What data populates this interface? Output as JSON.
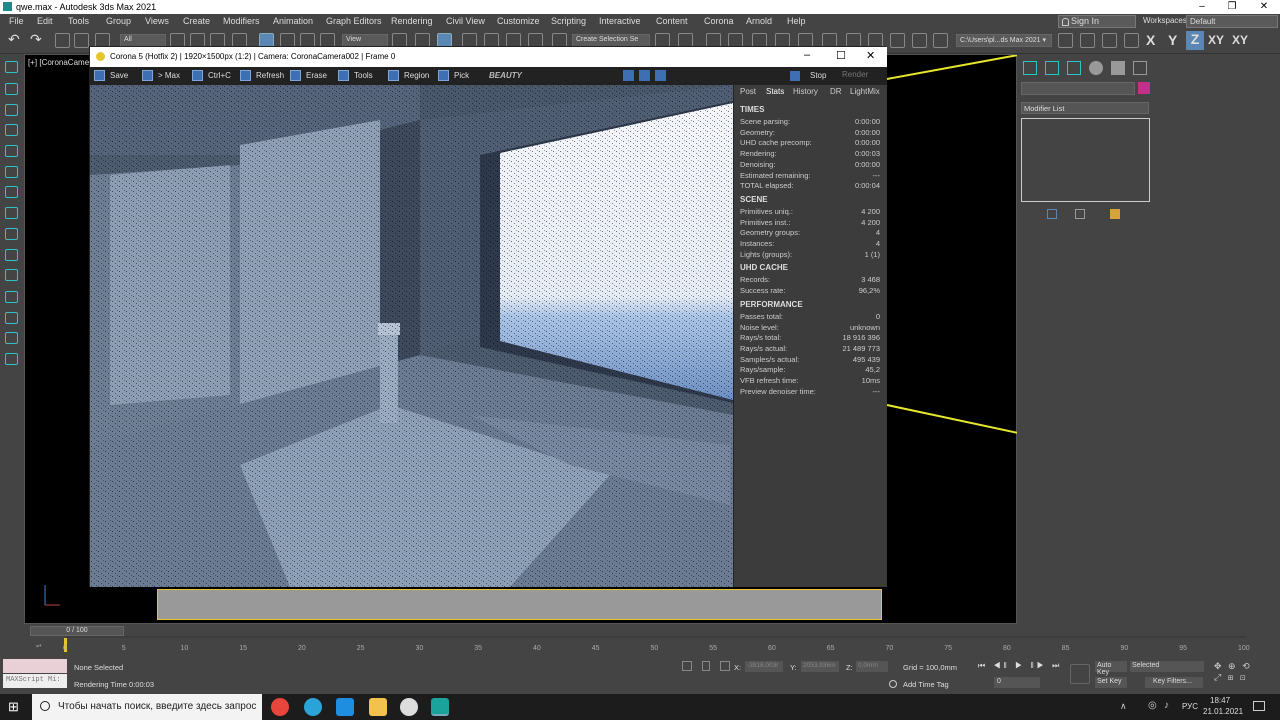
{
  "app": {
    "title": "qwe.max - Autodesk 3ds Max 2021"
  },
  "menu": [
    "File",
    "Edit",
    "Tools",
    "Group",
    "Views",
    "Create",
    "Modifiers",
    "Animation",
    "Graph Editors",
    "Rendering",
    "Civil View",
    "Customize",
    "Scripting",
    "Interactive",
    "Content",
    "Corona",
    "Arnold",
    "Help"
  ],
  "account": {
    "sign_in": "Sign In",
    "workspaces_label": "Workspaces:",
    "workspace": "Default"
  },
  "toolbar": {
    "filter": "All",
    "view": "View",
    "selection_set": "Create Selection Se",
    "path": "C:\\Users\\pl...ds Max 2021 ▾",
    "axes": [
      "X",
      "Y",
      "Z",
      "XY",
      "XY"
    ]
  },
  "viewport": {
    "label": "[+] [CoronaCamer"
  },
  "vfb": {
    "title": "Corona 5 (Hotfix 2) | 1920×1500px (1:2) | Camera: CoronaCamera002 | Frame 0",
    "buttons": [
      "Save",
      "> Max",
      "Ctrl+C",
      "Refresh",
      "Erase",
      "Tools",
      "Region",
      "Pick"
    ],
    "channel": "BEAUTY",
    "stop": "Stop",
    "render": "Render",
    "tabs": [
      "Post",
      "Stats",
      "History",
      "DR",
      "LightMix"
    ],
    "sections": {
      "times": {
        "title": "TIMES",
        "rows": [
          [
            "Scene parsing:",
            "0:00:00"
          ],
          [
            "Geometry:",
            "0:00:00"
          ],
          [
            "UHD cache precomp:",
            "0:00:00"
          ],
          [
            "Rendering:",
            "0:00:03"
          ],
          [
            "Denoising:",
            "0:00:00"
          ],
          [
            "Estimated remaining:",
            "---"
          ],
          [
            "TOTAL elapsed:",
            "0:00:04"
          ]
        ]
      },
      "scene": {
        "title": "SCENE",
        "rows": [
          [
            "Primitives uniq.:",
            "4 200"
          ],
          [
            "Primitives inst.:",
            "4 200"
          ],
          [
            "Geometry groups:",
            "4"
          ],
          [
            "Instances:",
            "4"
          ],
          [
            "Lights (groups):",
            "1 (1)"
          ]
        ]
      },
      "uhd": {
        "title": "UHD CACHE",
        "rows": [
          [
            "Records:",
            "3 468"
          ],
          [
            "Success rate:",
            "96,2%"
          ]
        ]
      },
      "perf": {
        "title": "PERFORMANCE",
        "rows": [
          [
            "Passes total:",
            "0"
          ],
          [
            "Noise level:",
            "unknown"
          ],
          [
            "Rays/s total:",
            "18 916 396"
          ],
          [
            "Rays/s actual:",
            "21 489 773"
          ],
          [
            "Samples/s actual:",
            "495 439"
          ],
          [
            "Rays/sample:",
            "45,2"
          ],
          [
            "VFB refresh time:",
            "10ms"
          ],
          [
            "Preview denoiser time:",
            "---"
          ]
        ]
      }
    }
  },
  "rightpanel": {
    "modifier_list": "Modifier List"
  },
  "timeline": {
    "frame": "0 / 100",
    "ticks": [
      "0",
      "5",
      "10",
      "15",
      "20",
      "25",
      "30",
      "35",
      "40",
      "45",
      "50",
      "55",
      "60",
      "65",
      "70",
      "75",
      "80",
      "85",
      "90",
      "95",
      "100"
    ]
  },
  "status": {
    "maxscript": "MAXScript Mi:",
    "selection": "None Selected",
    "render_time": "Rendering Time  0:00:03",
    "x_label": "X:",
    "x": "-3818,003r",
    "y_label": "Y:",
    "y": "2053,936m",
    "z_label": "Z:",
    "z": "0,0mm",
    "grid": "Grid = 100,0mm",
    "add_time_tag": "Add Time Tag",
    "auto_key": "Auto Key",
    "selected": "Selected",
    "set_key": "Set Key",
    "key_filters": "Key Filters...",
    "frame_field": "0"
  },
  "taskbar": {
    "search": "Чтобы начать поиск, введите здесь запрос",
    "lang": "РУС",
    "time": "18:47",
    "date": "21.01.2021"
  },
  "colors": {
    "accent": "#5b87b5",
    "viewport_border": "#e6c52d",
    "vfb_blue": "#3d6fb2"
  }
}
